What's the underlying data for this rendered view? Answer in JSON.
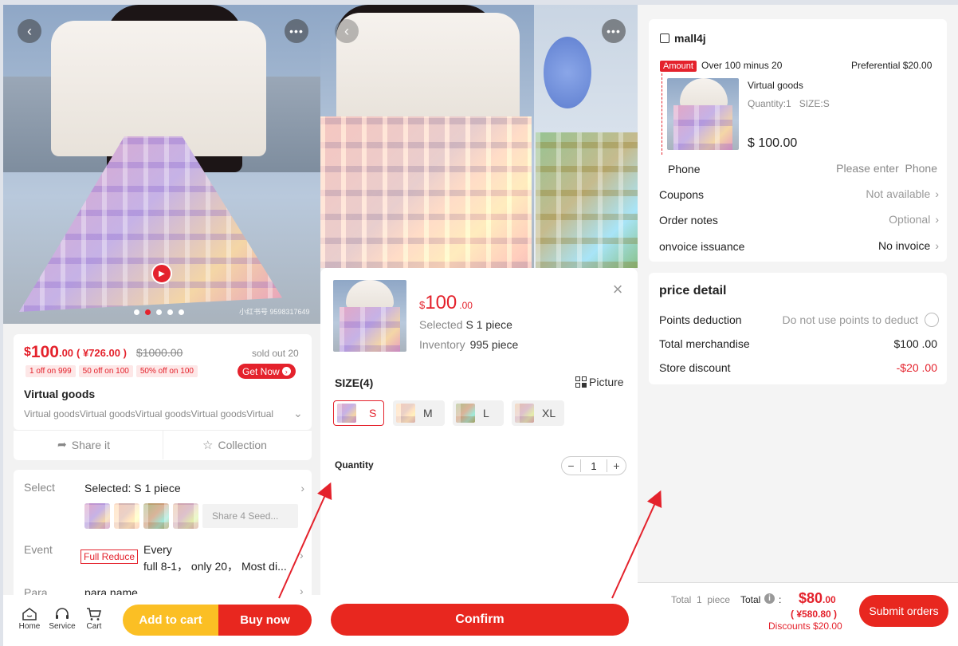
{
  "panel1": {
    "play_icon": "play-icon",
    "gallery_dots": 5,
    "gallery_active_dot": 2,
    "watermark": "小红书号 9598317649",
    "price_symbol": "$",
    "price_int": "100",
    "price_dec": ".00",
    "price_cny": "( ¥726.00 )",
    "price_original": "$1000.00",
    "sold": "sold out 20",
    "tags": [
      "1 off on 999",
      "50 off on 100",
      "50% off on 100"
    ],
    "get_now": "Get Now",
    "title": "Virtual goods",
    "desc": "Virtual goodsVirtual goodsVirtual goodsVirtual goodsVirtual",
    "share": "Share it",
    "collection": "Collection",
    "select_label": "Select",
    "select_value": "Selected: S   1   piece",
    "share_seeds": "Share 4 Seed...",
    "event_label": "Event",
    "event_badge": "Full Reduce",
    "event_line1": "Every",
    "event_line2": "full 8-1， only 20， Most di...",
    "para_label": "Para",
    "para_value": "para name",
    "nav": [
      {
        "label": "Home"
      },
      {
        "label": "Service"
      },
      {
        "label": "Cart"
      }
    ],
    "add_to_cart": "Add to cart",
    "buy_now": "Buy now"
  },
  "panel2": {
    "price_symbol": "$",
    "price_int": "100",
    "price_dec": ".00",
    "selected_label": "Selected",
    "selected_value": "S 1  piece",
    "inventory_label": "Inventory",
    "inventory_value": "995 piece",
    "size_heading": "SIZE(4)",
    "picture_label": "Picture",
    "sizes": [
      "S",
      "M",
      "L",
      "XL"
    ],
    "quantity_label": "Quantity",
    "quantity_value": "1",
    "minus": "−",
    "plus": "+",
    "confirm": "Confirm"
  },
  "panel3": {
    "shop_name": "mall4j",
    "amount_badge": "Amount",
    "promo_text": "Over 100 minus 20",
    "preferential": "Preferential $20.00",
    "item_title": "Virtual goods",
    "item_meta": "Quantity:1   SIZE:S",
    "item_price": "$ 100.00",
    "phone_label": "Phone",
    "phone_placeholder": "Please enter  Phone",
    "coupons_label": "Coupons",
    "coupons_value": "Not available",
    "notes_label": "Order notes",
    "notes_value": "Optional",
    "invoice_label": "onvoice issuance",
    "invoice_value": "No invoice",
    "price_detail_heading": "price detail",
    "points_label": "Points deduction",
    "points_value": "Do not use points to deduct",
    "merch_label": "Total merchandise",
    "merch_value": "$100 .00",
    "discount_label": "Store discount",
    "discount_value": "-$20 .00",
    "total_count": "Total  1  piece",
    "total_label": "Total",
    "total_colon": ":",
    "total_int": "$80",
    "total_dec": ".00",
    "total_cny": "( ¥580.80 )",
    "discounts": "Discounts $20.00",
    "submit": "Submit orders"
  },
  "colors": {
    "accent_red": "#e4222c",
    "yellow": "#fbbf24"
  }
}
